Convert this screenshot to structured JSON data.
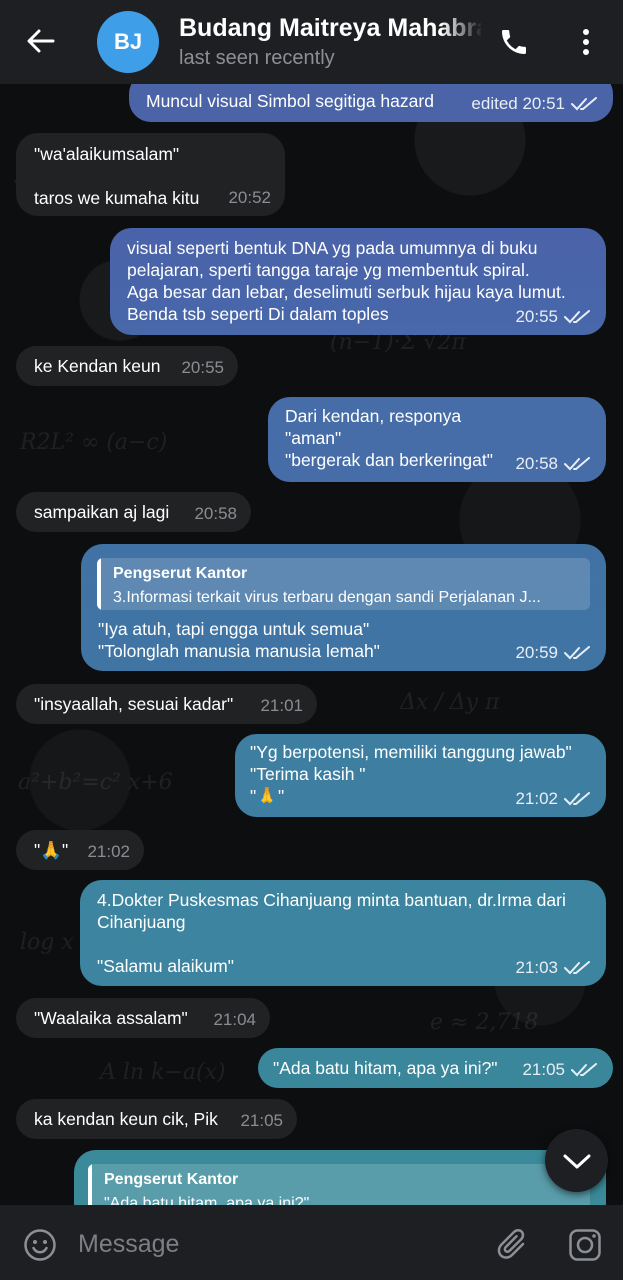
{
  "header": {
    "avatar_initials": "BJ",
    "name": "Budang Maitreya Mahabrata",
    "status": "last seen recently"
  },
  "messages": [
    {
      "dir": "out",
      "text": "Muncul visual Simbol segitiga hazard",
      "time": "edited 20:51"
    },
    {
      "dir": "in",
      "text": "\"wa'alaikumsalam\"\n\ntaros we kumaha kitu",
      "time": "20:52"
    },
    {
      "dir": "out",
      "text": "visual seperti bentuk DNA yg pada umumnya di buku\npelajaran, sperti tangga taraje yg membentuk spiral.\nAga besar dan lebar, deselimuti serbuk hijau kaya lumut.\nBenda tsb seperti Di dalam toples",
      "time": "20:55"
    },
    {
      "dir": "in",
      "text": "ke Kendan keun",
      "time": "20:55"
    },
    {
      "dir": "out",
      "text": "Dari kendan, responya\n\"aman\"\n\"bergerak dan berkeringat\"",
      "time": "20:58"
    },
    {
      "dir": "in",
      "text": "sampaikan aj lagi",
      "time": "20:58"
    },
    {
      "dir": "out",
      "reply_name": "Pengserut Kantor",
      "reply_text": "3.Informasi terkait virus terbaru dengan sandi Perjalanan J...",
      "text": "\"Iya atuh, tapi engga untuk semua\"\n\"Tolonglah manusia manusia lemah\"",
      "time": "20:59"
    },
    {
      "dir": "in",
      "text": "\"insyaallah, sesuai kadar\"",
      "time": "21:01"
    },
    {
      "dir": "out",
      "text": "\"Yg berpotensi, memiliki tanggung jawab\"\n\"Terima kasih \"\n\"🙏\"",
      "time": "21:02"
    },
    {
      "dir": "in",
      "text": "\"🙏\"",
      "time": "21:02"
    },
    {
      "dir": "out",
      "text": "4.Dokter Puskesmas Cihanjuang minta bantuan, dr.Irma dari\nCihanjuang\n\n\"Salamu alaikum\"",
      "time": "21:03"
    },
    {
      "dir": "in",
      "text": "\"Waalaika assalam\"",
      "time": "21:04"
    },
    {
      "dir": "out",
      "text": "\"Ada batu hitam, apa ya ini?\"",
      "time": "21:05"
    },
    {
      "dir": "in",
      "text": "ka kendan keun cik, Pik",
      "time": "21:05"
    },
    {
      "dir": "out",
      "reply_name": "Pengserut Kantor",
      "reply_text": "\"Ada batu hitam, apa ya ini?\"",
      "text": "",
      "time": ""
    }
  ],
  "input": {
    "placeholder": "Message"
  },
  "icons": {
    "back": "arrow-left-icon",
    "call": "phone-icon",
    "more": "kebab-menu-icon",
    "emoji": "smile-icon",
    "attach": "paperclip-icon",
    "camera": "camera-icon",
    "scroll": "chevron-down-icon"
  },
  "colors": {
    "outgoing_top": "#4b64a8",
    "outgoing_bottom": "#3f8a9a",
    "incoming": "#212224",
    "header": "#1e1f22",
    "avatar": "#3f9ee8"
  }
}
